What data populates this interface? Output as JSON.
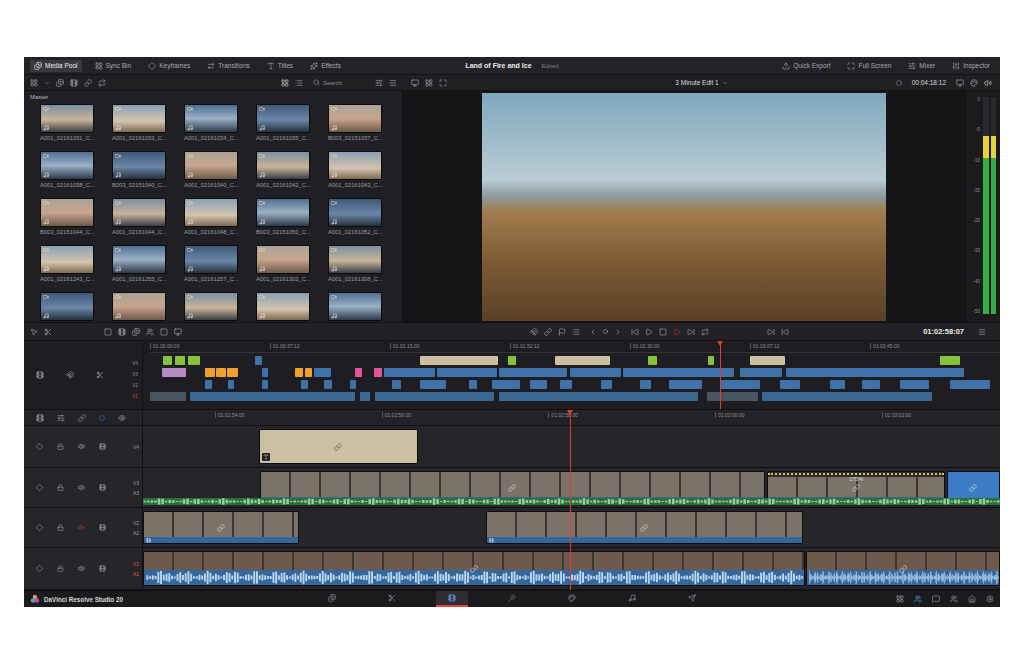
{
  "app": {
    "title": "Land of Fire and Ice",
    "status": "Edited",
    "product": "DaVinci Resolve Studio 20"
  },
  "toolbar": {
    "left": [
      {
        "label": "Media Pool",
        "selected": true
      },
      {
        "label": "Sync Bin",
        "selected": false
      },
      {
        "label": "Keyframes",
        "selected": false
      },
      {
        "label": "Transitions",
        "selected": false
      },
      {
        "label": "Titles",
        "selected": false
      },
      {
        "label": "Effects",
        "selected": false
      }
    ],
    "right": [
      {
        "label": "Quick Export",
        "selected": false
      },
      {
        "label": "Full Screen",
        "selected": false
      },
      {
        "label": "Mixer",
        "selected": false
      },
      {
        "label": "Inspector",
        "selected": false
      }
    ]
  },
  "media_pool": {
    "bin": "Master",
    "search": {
      "placeholder": "Search"
    },
    "clips": [
      {
        "label": "A001_02161031_C..."
      },
      {
        "label": "A001_02161033_C..."
      },
      {
        "label": "A001_02161034_C..."
      },
      {
        "label": "A001_02161035_C..."
      },
      {
        "label": "B003_02151037_C..."
      },
      {
        "label": "A001_02161038_C..."
      },
      {
        "label": "B003_02151040_C..."
      },
      {
        "label": "A001_02161040_C..."
      },
      {
        "label": "A001_02161042_C..."
      },
      {
        "label": "A001_02161043_C..."
      },
      {
        "label": "B003_02151044_C..."
      },
      {
        "label": "A001_02161044_C..."
      },
      {
        "label": "A001_02161048_C..."
      },
      {
        "label": "B003_02151050_C..."
      },
      {
        "label": "A001_02161052_C..."
      },
      {
        "label": "A001_02161243_C..."
      },
      {
        "label": "A001_02161255_C..."
      },
      {
        "label": "A001_02161257_C..."
      },
      {
        "label": "A001_02161302_C..."
      },
      {
        "label": "A001_02161308_C..."
      },
      {
        "label": ""
      },
      {
        "label": ""
      },
      {
        "label": ""
      },
      {
        "label": ""
      },
      {
        "label": ""
      }
    ]
  },
  "viewer": {
    "timeline_name": "3 Minute Edit 1",
    "timecode": "00:04:18:12",
    "playback_timecode": "01:02:58:07"
  },
  "meter": {
    "scale": [
      "0",
      "-5",
      "-10",
      "-15",
      "-20",
      "-30",
      "-40",
      "-50"
    ],
    "channels": [
      {
        "level": 0.82
      },
      {
        "level": 0.82
      }
    ]
  },
  "overview": {
    "ruler": [
      "01:00:00:00",
      "01:00:37:12",
      "01:01:15:00",
      "01:01:52:12",
      "01:02:30:00",
      "01:03:07:12",
      "01:03:45:00"
    ],
    "playhead": 0.67,
    "lanes": [
      {
        "label": "V4",
        "clips": [
          {
            "at": 0.015,
            "len": 0.011,
            "color": "#86c23b"
          },
          {
            "at": 0.029,
            "len": 0.012,
            "color": "#86c23b"
          },
          {
            "at": 0.045,
            "len": 0.014,
            "color": "#86c23b"
          },
          {
            "at": 0.124,
            "len": 0.008,
            "color": "#3f72a8"
          },
          {
            "at": 0.318,
            "len": 0.092,
            "color": "#cdc19f"
          },
          {
            "at": 0.421,
            "len": 0.01,
            "color": "#86c23b"
          },
          {
            "at": 0.476,
            "len": 0.065,
            "color": "#cdc19f"
          },
          {
            "at": 0.586,
            "len": 0.01,
            "color": "#86c23b"
          },
          {
            "at": 0.656,
            "len": 0.007,
            "color": "#86c23b"
          },
          {
            "at": 0.706,
            "len": 0.041,
            "color": "#cdc19f"
          },
          {
            "at": 0.929,
            "len": 0.024,
            "color": "#86c23b"
          }
        ]
      },
      {
        "label": "V3",
        "clips": [
          {
            "at": 0.014,
            "len": 0.028,
            "color": "#b58cc4"
          },
          {
            "at": 0.065,
            "len": 0.011,
            "color": "#f0a030"
          },
          {
            "at": 0.078,
            "len": 0.011,
            "color": "#f0a030"
          },
          {
            "at": 0.091,
            "len": 0.012,
            "color": "#f0a030"
          },
          {
            "at": 0.132,
            "len": 0.007,
            "color": "#3f72a8"
          },
          {
            "at": 0.171,
            "len": 0.009,
            "color": "#f0a030"
          },
          {
            "at": 0.182,
            "len": 0.009,
            "color": "#f0a030"
          },
          {
            "at": 0.193,
            "len": 0.02,
            "color": "#3f72a8"
          },
          {
            "at": 0.241,
            "len": 0.008,
            "color": "#e0559c"
          },
          {
            "at": 0.264,
            "len": 0.009,
            "color": "#e0559c"
          },
          {
            "at": 0.275,
            "len": 0.06,
            "color": "#3f72a8"
          },
          {
            "at": 0.338,
            "len": 0.07,
            "color": "#3f72a8"
          },
          {
            "at": 0.411,
            "len": 0.08,
            "color": "#3f72a8"
          },
          {
            "at": 0.494,
            "len": 0.06,
            "color": "#3f72a8"
          },
          {
            "at": 0.557,
            "len": 0.13,
            "color": "#3f72a8"
          },
          {
            "at": 0.694,
            "len": 0.05,
            "color": "#3f72a8"
          },
          {
            "at": 0.748,
            "len": 0.21,
            "color": "#3f72a8"
          }
        ]
      },
      {
        "label": "V2",
        "clips": [
          {
            "at": 0.065,
            "len": 0.008,
            "color": "#3f72a8"
          },
          {
            "at": 0.092,
            "len": 0.007,
            "color": "#3f72a8"
          },
          {
            "at": 0.132,
            "len": 0.007,
            "color": "#3f72a8"
          },
          {
            "at": 0.178,
            "len": 0.008,
            "color": "#3f72a8"
          },
          {
            "at": 0.205,
            "len": 0.009,
            "color": "#3f72a8"
          },
          {
            "at": 0.235,
            "len": 0.007,
            "color": "#3f72a8"
          },
          {
            "at": 0.285,
            "len": 0.01,
            "color": "#3f72a8"
          },
          {
            "at": 0.318,
            "len": 0.03,
            "color": "#3f72a8"
          },
          {
            "at": 0.375,
            "len": 0.01,
            "color": "#3f72a8"
          },
          {
            "at": 0.402,
            "len": 0.033,
            "color": "#3f72a8"
          },
          {
            "at": 0.447,
            "len": 0.02,
            "color": "#3f72a8"
          },
          {
            "at": 0.482,
            "len": 0.014,
            "color": "#3f72a8"
          },
          {
            "at": 0.53,
            "len": 0.014,
            "color": "#3f72a8"
          },
          {
            "at": 0.576,
            "len": 0.014,
            "color": "#3f72a8"
          },
          {
            "at": 0.611,
            "len": 0.038,
            "color": "#3f72a8"
          },
          {
            "at": 0.671,
            "len": 0.047,
            "color": "#3f72a8"
          },
          {
            "at": 0.741,
            "len": 0.024,
            "color": "#3f72a8"
          },
          {
            "at": 0.8,
            "len": 0.018,
            "color": "#3f72a8"
          },
          {
            "at": 0.838,
            "len": 0.021,
            "color": "#3f72a8"
          },
          {
            "at": 0.882,
            "len": 0.035,
            "color": "#3f72a8"
          },
          {
            "at": 0.941,
            "len": 0.047,
            "color": "#3f72a8"
          }
        ]
      },
      {
        "label": "V1",
        "clips": [
          {
            "at": 0.0,
            "len": 0.042,
            "color": "#4a5563"
          },
          {
            "at": 0.047,
            "len": 0.194,
            "color": "#3c6896"
          },
          {
            "at": 0.247,
            "len": 0.012,
            "color": "#3c6896"
          },
          {
            "at": 0.265,
            "len": 0.14,
            "color": "#3c6896"
          },
          {
            "at": 0.41,
            "len": 0.235,
            "color": "#3c6896"
          },
          {
            "at": 0.655,
            "len": 0.06,
            "color": "#4a5563"
          },
          {
            "at": 0.72,
            "len": 0.2,
            "color": "#3c6896"
          }
        ]
      }
    ]
  },
  "timeline": {
    "ruler": [
      "01:02:54:00",
      "01:02:56:00",
      "01:02:58:00",
      "01:03:00:00",
      "01:03:02:00"
    ],
    "playhead": 0.498,
    "tracks": [
      {
        "labels": [
          "V4"
        ],
        "kind": "title",
        "muted": false,
        "destination": false,
        "audio_strip": false,
        "clips": [
          {
            "at": 0.135,
            "len": 0.186,
            "selected": false
          }
        ]
      },
      {
        "labels": [
          "V3",
          "A3"
        ],
        "kind": "video",
        "muted": false,
        "destination": false,
        "audio_strip": true,
        "clips": [
          {
            "at": 0.1365,
            "len": 0.589,
            "selected": false
          },
          {
            "at": 0.728,
            "len": 0.208,
            "selected": false,
            "speed": "175%"
          },
          {
            "at": 0.938,
            "len": 0.062,
            "selected": true
          }
        ]
      },
      {
        "labels": [
          "V2",
          "A2"
        ],
        "kind": "video",
        "muted": true,
        "destination": false,
        "audio_strip": false,
        "clips": [
          {
            "at": 0.0,
            "len": 0.182,
            "selected": false
          },
          {
            "at": 0.4,
            "len": 0.37,
            "selected": false
          }
        ]
      },
      {
        "labels": [
          "V1",
          "A1"
        ],
        "kind": "video-wave",
        "muted": false,
        "destination": true,
        "audio_strip": false,
        "clips": [
          {
            "at": 0.0,
            "len": 0.772,
            "selected": false
          },
          {
            "at": 0.774,
            "len": 0.226,
            "selected": false
          }
        ]
      }
    ]
  },
  "pages": [
    {
      "selected": false
    },
    {
      "selected": false
    },
    {
      "selected": true
    },
    {
      "selected": false
    },
    {
      "selected": false
    },
    {
      "selected": false
    },
    {
      "selected": false
    }
  ]
}
